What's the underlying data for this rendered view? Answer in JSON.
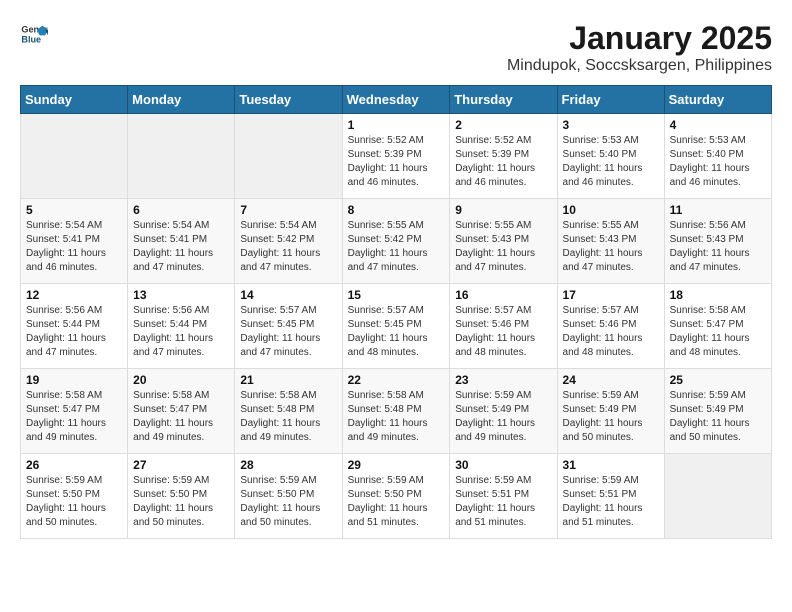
{
  "header": {
    "logo_general": "General",
    "logo_blue": "Blue",
    "title": "January 2025",
    "subtitle": "Mindupok, Soccsksargen, Philippines"
  },
  "calendar": {
    "days_of_week": [
      "Sunday",
      "Monday",
      "Tuesday",
      "Wednesday",
      "Thursday",
      "Friday",
      "Saturday"
    ],
    "weeks": [
      [
        {
          "day": "",
          "info": ""
        },
        {
          "day": "",
          "info": ""
        },
        {
          "day": "",
          "info": ""
        },
        {
          "day": "1",
          "info": "Sunrise: 5:52 AM\nSunset: 5:39 PM\nDaylight: 11 hours and 46 minutes."
        },
        {
          "day": "2",
          "info": "Sunrise: 5:52 AM\nSunset: 5:39 PM\nDaylight: 11 hours and 46 minutes."
        },
        {
          "day": "3",
          "info": "Sunrise: 5:53 AM\nSunset: 5:40 PM\nDaylight: 11 hours and 46 minutes."
        },
        {
          "day": "4",
          "info": "Sunrise: 5:53 AM\nSunset: 5:40 PM\nDaylight: 11 hours and 46 minutes."
        }
      ],
      [
        {
          "day": "5",
          "info": "Sunrise: 5:54 AM\nSunset: 5:41 PM\nDaylight: 11 hours and 46 minutes."
        },
        {
          "day": "6",
          "info": "Sunrise: 5:54 AM\nSunset: 5:41 PM\nDaylight: 11 hours and 47 minutes."
        },
        {
          "day": "7",
          "info": "Sunrise: 5:54 AM\nSunset: 5:42 PM\nDaylight: 11 hours and 47 minutes."
        },
        {
          "day": "8",
          "info": "Sunrise: 5:55 AM\nSunset: 5:42 PM\nDaylight: 11 hours and 47 minutes."
        },
        {
          "day": "9",
          "info": "Sunrise: 5:55 AM\nSunset: 5:43 PM\nDaylight: 11 hours and 47 minutes."
        },
        {
          "day": "10",
          "info": "Sunrise: 5:55 AM\nSunset: 5:43 PM\nDaylight: 11 hours and 47 minutes."
        },
        {
          "day": "11",
          "info": "Sunrise: 5:56 AM\nSunset: 5:43 PM\nDaylight: 11 hours and 47 minutes."
        }
      ],
      [
        {
          "day": "12",
          "info": "Sunrise: 5:56 AM\nSunset: 5:44 PM\nDaylight: 11 hours and 47 minutes."
        },
        {
          "day": "13",
          "info": "Sunrise: 5:56 AM\nSunset: 5:44 PM\nDaylight: 11 hours and 47 minutes."
        },
        {
          "day": "14",
          "info": "Sunrise: 5:57 AM\nSunset: 5:45 PM\nDaylight: 11 hours and 47 minutes."
        },
        {
          "day": "15",
          "info": "Sunrise: 5:57 AM\nSunset: 5:45 PM\nDaylight: 11 hours and 48 minutes."
        },
        {
          "day": "16",
          "info": "Sunrise: 5:57 AM\nSunset: 5:46 PM\nDaylight: 11 hours and 48 minutes."
        },
        {
          "day": "17",
          "info": "Sunrise: 5:57 AM\nSunset: 5:46 PM\nDaylight: 11 hours and 48 minutes."
        },
        {
          "day": "18",
          "info": "Sunrise: 5:58 AM\nSunset: 5:47 PM\nDaylight: 11 hours and 48 minutes."
        }
      ],
      [
        {
          "day": "19",
          "info": "Sunrise: 5:58 AM\nSunset: 5:47 PM\nDaylight: 11 hours and 49 minutes."
        },
        {
          "day": "20",
          "info": "Sunrise: 5:58 AM\nSunset: 5:47 PM\nDaylight: 11 hours and 49 minutes."
        },
        {
          "day": "21",
          "info": "Sunrise: 5:58 AM\nSunset: 5:48 PM\nDaylight: 11 hours and 49 minutes."
        },
        {
          "day": "22",
          "info": "Sunrise: 5:58 AM\nSunset: 5:48 PM\nDaylight: 11 hours and 49 minutes."
        },
        {
          "day": "23",
          "info": "Sunrise: 5:59 AM\nSunset: 5:49 PM\nDaylight: 11 hours and 49 minutes."
        },
        {
          "day": "24",
          "info": "Sunrise: 5:59 AM\nSunset: 5:49 PM\nDaylight: 11 hours and 50 minutes."
        },
        {
          "day": "25",
          "info": "Sunrise: 5:59 AM\nSunset: 5:49 PM\nDaylight: 11 hours and 50 minutes."
        }
      ],
      [
        {
          "day": "26",
          "info": "Sunrise: 5:59 AM\nSunset: 5:50 PM\nDaylight: 11 hours and 50 minutes."
        },
        {
          "day": "27",
          "info": "Sunrise: 5:59 AM\nSunset: 5:50 PM\nDaylight: 11 hours and 50 minutes."
        },
        {
          "day": "28",
          "info": "Sunrise: 5:59 AM\nSunset: 5:50 PM\nDaylight: 11 hours and 50 minutes."
        },
        {
          "day": "29",
          "info": "Sunrise: 5:59 AM\nSunset: 5:50 PM\nDaylight: 11 hours and 51 minutes."
        },
        {
          "day": "30",
          "info": "Sunrise: 5:59 AM\nSunset: 5:51 PM\nDaylight: 11 hours and 51 minutes."
        },
        {
          "day": "31",
          "info": "Sunrise: 5:59 AM\nSunset: 5:51 PM\nDaylight: 11 hours and 51 minutes."
        },
        {
          "day": "",
          "info": ""
        }
      ]
    ]
  }
}
